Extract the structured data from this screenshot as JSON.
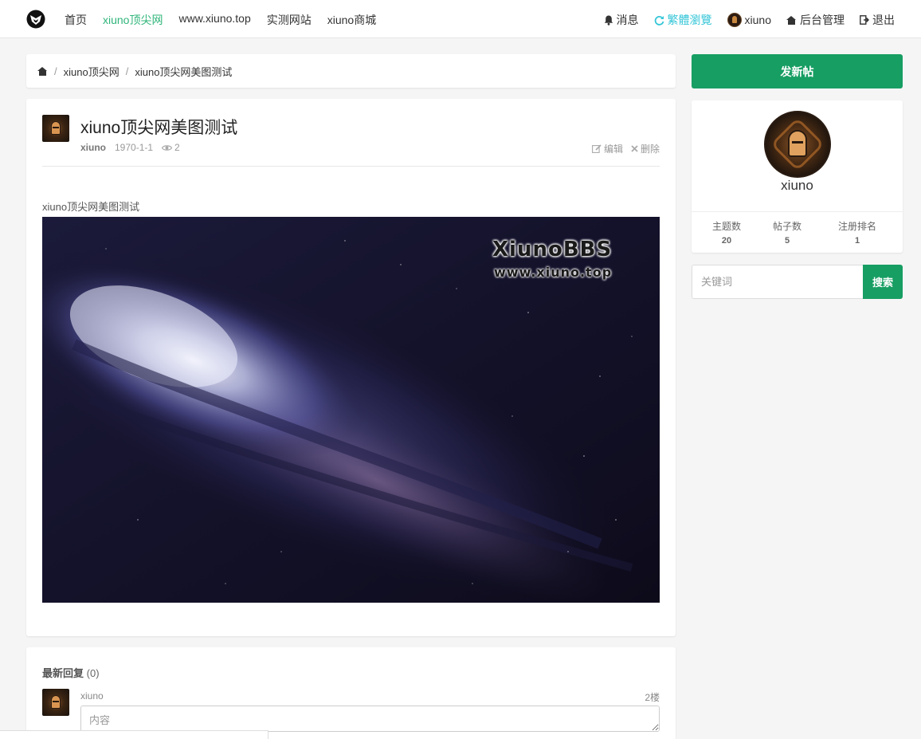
{
  "nav": {
    "logo_icon": "xiuno-logo-icon",
    "left_links": [
      {
        "label": "首页"
      },
      {
        "label": "xiuno顶尖网",
        "active": true
      },
      {
        "label": "www.xiuno.top"
      },
      {
        "label": "实测网站"
      },
      {
        "label": "xiuno商城"
      }
    ],
    "messages": "消息",
    "traditional": "繁體瀏覽",
    "username": "xiuno",
    "admin": "后台管理",
    "logout": "退出"
  },
  "breadcrumb": {
    "forum": "xiuno顶尖网",
    "current": "xiuno顶尖网美图测试"
  },
  "post": {
    "title": "xiuno顶尖网美图测试",
    "author": "xiuno",
    "date": "1970-1-1",
    "views": "2",
    "edit": "编辑",
    "delete": "删除",
    "body_text": "xiuno顶尖网美图测试",
    "image_watermark_title": "XiunoBBS",
    "image_watermark_url": "www.xiuno.top"
  },
  "sidebar": {
    "new_post": "发新帖",
    "profile": {
      "name": "xiuno",
      "stats": [
        {
          "label": "主题数",
          "value": "20"
        },
        {
          "label": "帖子数",
          "value": "5"
        },
        {
          "label": "注册排名",
          "value": "1"
        }
      ]
    },
    "search": {
      "placeholder": "关键词",
      "button": "搜索"
    }
  },
  "replies": {
    "title": "最新回复",
    "count": "(0)",
    "user": "xiuno",
    "floor": "2楼",
    "placeholder": "内容"
  },
  "colors": {
    "accent_green": "#179e63",
    "active_link": "#2fb57a",
    "traditional_link": "#36c6d8"
  }
}
